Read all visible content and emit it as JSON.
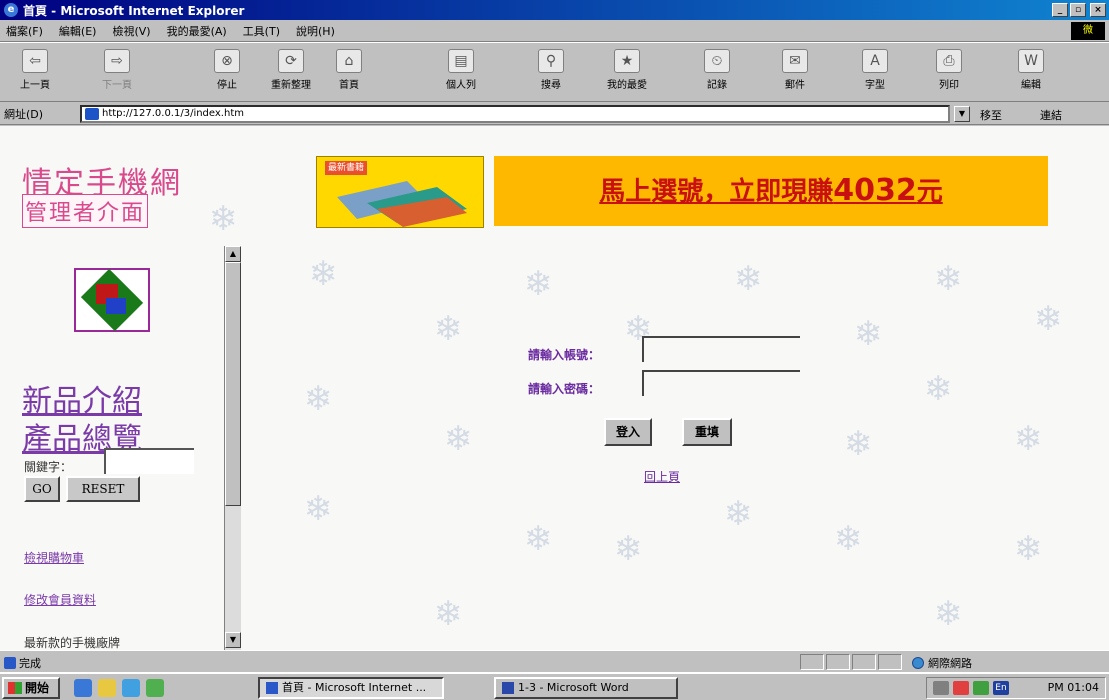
{
  "window": {
    "title": "首頁 - Microsoft Internet Explorer",
    "ctrl_min": "_",
    "ctrl_max": "▫",
    "ctrl_close": "×"
  },
  "menubar": {
    "items": [
      "檔案(F)",
      "編輯(E)",
      "檢視(V)",
      "我的最愛(A)",
      "工具(T)",
      "說明(H)"
    ],
    "logo_text": "微"
  },
  "toolbar": {
    "buttons": [
      {
        "label": "上一頁",
        "icon": "back-arrow-icon",
        "glyph": "⇦"
      },
      {
        "label": "下一頁",
        "icon": "forward-arrow-icon",
        "glyph": "⇨"
      },
      {
        "label": "停止",
        "icon": "stop-icon",
        "glyph": "⊗"
      },
      {
        "label": "重新整理",
        "icon": "refresh-icon",
        "glyph": "⟳"
      },
      {
        "label": "首頁",
        "icon": "home-icon",
        "glyph": "⌂"
      },
      {
        "label": "個人列",
        "icon": "personal-bar-icon",
        "glyph": "▤"
      },
      {
        "label": "搜尋",
        "icon": "search-icon",
        "glyph": "⚲"
      },
      {
        "label": "我的最愛",
        "icon": "favorites-icon",
        "glyph": "★"
      },
      {
        "label": "記錄",
        "icon": "history-icon",
        "glyph": "⏲"
      },
      {
        "label": "郵件",
        "icon": "mail-icon",
        "glyph": "✉"
      },
      {
        "label": "字型",
        "icon": "font-icon",
        "glyph": "A"
      },
      {
        "label": "列印",
        "icon": "print-icon",
        "glyph": "⎙"
      },
      {
        "label": "編輯",
        "icon": "edit-icon",
        "glyph": "W"
      }
    ]
  },
  "address": {
    "label": "網址(D)",
    "url": "http://127.0.0.1/3/index.htm",
    "go_label": "移至",
    "links_label": "連結"
  },
  "page": {
    "site_title": "情定手機網",
    "admin_title": "管理者介面",
    "book_label": "最新書籍",
    "banner_text": "馬上選號，立即現賺",
    "banner_amount": "4032",
    "banner_unit": "元",
    "nav_new": "新品介紹",
    "nav_all": "產品總覽",
    "keyword_label": "關鍵字：",
    "go_button": "GO",
    "reset_button": "RESET",
    "link_cart": "檢視購物車",
    "link_member": "修改會員資料",
    "more_text": "最新款的手機廠牌",
    "form": {
      "account_label": "請輸入帳號：",
      "password_label": "請輸入密碼：",
      "login_button": "登入",
      "clear_button": "重填",
      "back_link": "回上頁"
    },
    "scroll_up": "▲",
    "scroll_down": "▼"
  },
  "status": {
    "text": "完成",
    "zone": "網際網路"
  },
  "taskbar": {
    "start": "開始",
    "tasks": [
      {
        "label": "首頁 - Microsoft Internet ...",
        "active": true
      },
      {
        "label": "1-3 - Microsoft Word",
        "active": false
      }
    ],
    "clock": "PM 01:04",
    "ime": "En"
  }
}
